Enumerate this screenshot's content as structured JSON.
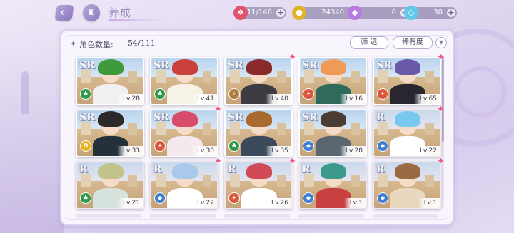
{
  "title": "养成",
  "resources": [
    {
      "id": "stamina",
      "icon": "candy-icon",
      "value": "11/146",
      "color": "#e0546e"
    },
    {
      "id": "gold",
      "icon": "coin-icon",
      "value": "24340",
      "color": "#e1b32f"
    },
    {
      "id": "gem",
      "icon": "purple-gem-icon",
      "value": "0",
      "color": "#b67ae0"
    },
    {
      "id": "diamond",
      "icon": "diamond-icon",
      "value": "30",
      "color": "#5fc9e8"
    }
  ],
  "plus_label": "+",
  "count": {
    "label": "角色数量:",
    "value": "54/111"
  },
  "filter_label": "筛 选",
  "rarity_label": "稀有度",
  "cards": [
    {
      "rank": "SR",
      "level": "Lv.28",
      "attr": "earth",
      "attr_color": "#2e9a4a",
      "hair": "#3f9a3c",
      "outfit": "#f0f0f0",
      "dot": false
    },
    {
      "rank": "SR",
      "level": "Lv.41",
      "attr": "earth",
      "attr_color": "#2e9a4a",
      "hair": "#c9403f",
      "outfit": "#f6f3e6",
      "dot": false
    },
    {
      "rank": "SR",
      "level": "Lv.40",
      "attr": "wind",
      "attr_color": "#b07a3a",
      "hair": "#8b2a2a",
      "outfit": "#3c3c42",
      "dot": true
    },
    {
      "rank": "SR",
      "level": "Lv.16",
      "attr": "fire",
      "attr_color": "#d9563c",
      "hair": "#ef9a57",
      "outfit": "#2f6a5c",
      "dot": false
    },
    {
      "rank": "SR",
      "level": "Lv.65",
      "attr": "fire",
      "attr_color": "#d9563c",
      "hair": "#6a58a8",
      "outfit": "#2a2630",
      "dot": true
    },
    {
      "rank": "SR",
      "level": "Lv.33",
      "attr": "light",
      "attr_color": "#e7b524",
      "hair": "#2a2a2a",
      "outfit": "#24303a",
      "dot": false
    },
    {
      "rank": "SR",
      "level": "Lv.30",
      "attr": "fire",
      "attr_color": "#d9563c",
      "hair": "#d94b6a",
      "outfit": "#f3e9ef",
      "dot": true
    },
    {
      "rank": "SR",
      "level": "Lv.35",
      "attr": "earth",
      "attr_color": "#2e9a4a",
      "hair": "#a96a2f",
      "outfit": "#3a4a5a",
      "dot": false
    },
    {
      "rank": "SR",
      "level": "Lv.28",
      "attr": "water",
      "attr_color": "#3f7fd1",
      "hair": "#4a3e34",
      "outfit": "#5a6670",
      "dot": false
    },
    {
      "rank": "R",
      "level": "Lv.22",
      "attr": "water",
      "attr_color": "#3f7fd1",
      "hair": "#79c9ee",
      "outfit": "#ffffff",
      "dot": true
    },
    {
      "rank": "R",
      "level": "Lv.21",
      "attr": "earth",
      "attr_color": "#2e9a4a",
      "hair": "#c2c38a",
      "outfit": "#d6e2dc",
      "dot": false
    },
    {
      "rank": "R",
      "level": "Lv.22",
      "attr": "water",
      "attr_color": "#3f7fd1",
      "hair": "#a9c8ea",
      "outfit": "#ffffff",
      "dot": true
    },
    {
      "rank": "R",
      "level": "Lv.26",
      "attr": "fire",
      "attr_color": "#d9563c",
      "hair": "#d04a56",
      "outfit": "#ffffff",
      "dot": true
    },
    {
      "rank": "R",
      "level": "Lv.1",
      "attr": "water",
      "attr_color": "#3f7fd1",
      "hair": "#3c9a8a",
      "outfit": "#c94040",
      "dot": false
    },
    {
      "rank": "R",
      "level": "Lv.1",
      "attr": "water",
      "attr_color": "#3f7fd1",
      "hair": "#9a6a42",
      "outfit": "#e9d7c0",
      "dot": true
    }
  ],
  "attr_glyphs": {
    "earth": "♣",
    "wind": "✧",
    "fire": "✦",
    "light": "✪",
    "water": "◆"
  },
  "icons": {
    "back": "back-arrow-icon",
    "home": "castle-home-icon",
    "count": "diamond-bullet-icon",
    "down": "chevron-down-icon"
  }
}
